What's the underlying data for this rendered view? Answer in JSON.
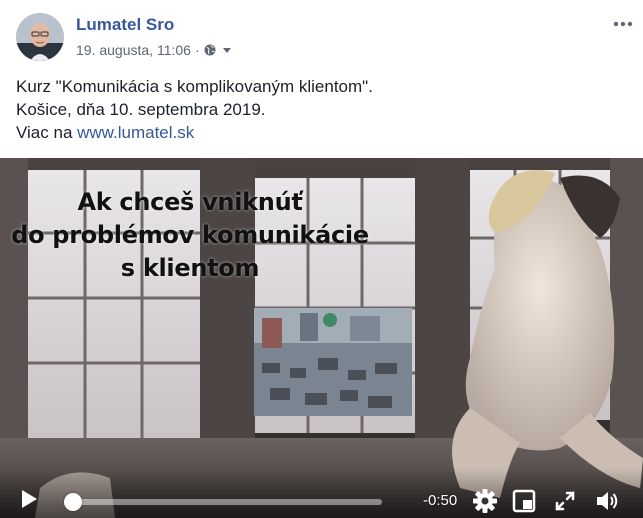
{
  "post": {
    "author": "Lumatel Sro",
    "timestamp": "19. augusta, 11:06",
    "separator": "·",
    "audience_icon": "globe-icon",
    "menu_icon": "more-options-icon",
    "text_line1": "Kurz \"Komunikácia s komplikovaným klientom\".",
    "text_line2": "Košice, dňa 10. septembra 2019.",
    "text_line3_prefix": "Viac na ",
    "link": "www.lumatel.sk"
  },
  "video": {
    "overlay_lines": [
      "Ak chceš vniknúť",
      "do problémov komunikácie",
      "s klientom"
    ],
    "time_remaining": "-0:50",
    "progress": 0.02,
    "controls": {
      "play_icon": "play-icon",
      "settings_icon": "gear-icon",
      "pip_icon": "picture-in-picture-icon",
      "fullscreen_icon": "fullscreen-icon",
      "volume_icon": "volume-icon"
    }
  },
  "colors": {
    "link": "#385898",
    "meta": "#606770",
    "text": "#1d2129"
  }
}
